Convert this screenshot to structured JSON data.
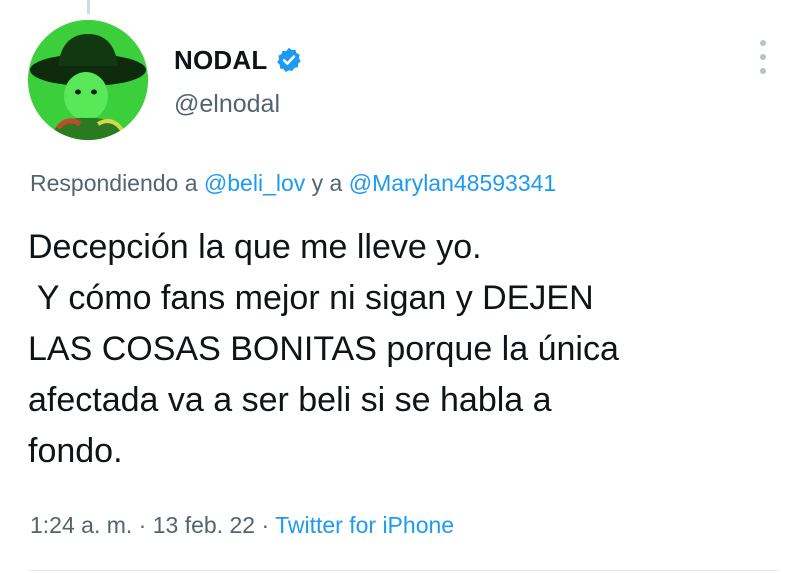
{
  "tweet": {
    "author": {
      "display_name": "NODAL",
      "handle": "@elnodal",
      "verified": true,
      "avatar_icon": "avatar-photo-cowboy-hat-green"
    },
    "reply": {
      "prefix": "Respondiendo a",
      "mention_1": "@beli_lov",
      "connector": "y a",
      "mention_2": "@Marylan48593341"
    },
    "text_lines": [
      "Decepción la que me lleve yo.",
      " Y cómo fans mejor ni sigan y DEJEN",
      "LAS COSAS BONITAS porque la única",
      "afectada va a ser beli si se habla a",
      "fondo."
    ],
    "meta": {
      "time": "1:24 a. m.",
      "separator_1": "·",
      "date": "13 feb. 22",
      "separator_2": "·",
      "source": "Twitter for iPhone"
    },
    "more_icon": "more-vertical-icon"
  },
  "colors": {
    "text_primary": "#0f1419",
    "text_secondary": "#536471",
    "link": "#1d9bf0",
    "verified": "#1d9bf0",
    "avatar_bg": "#3fcf3f"
  }
}
